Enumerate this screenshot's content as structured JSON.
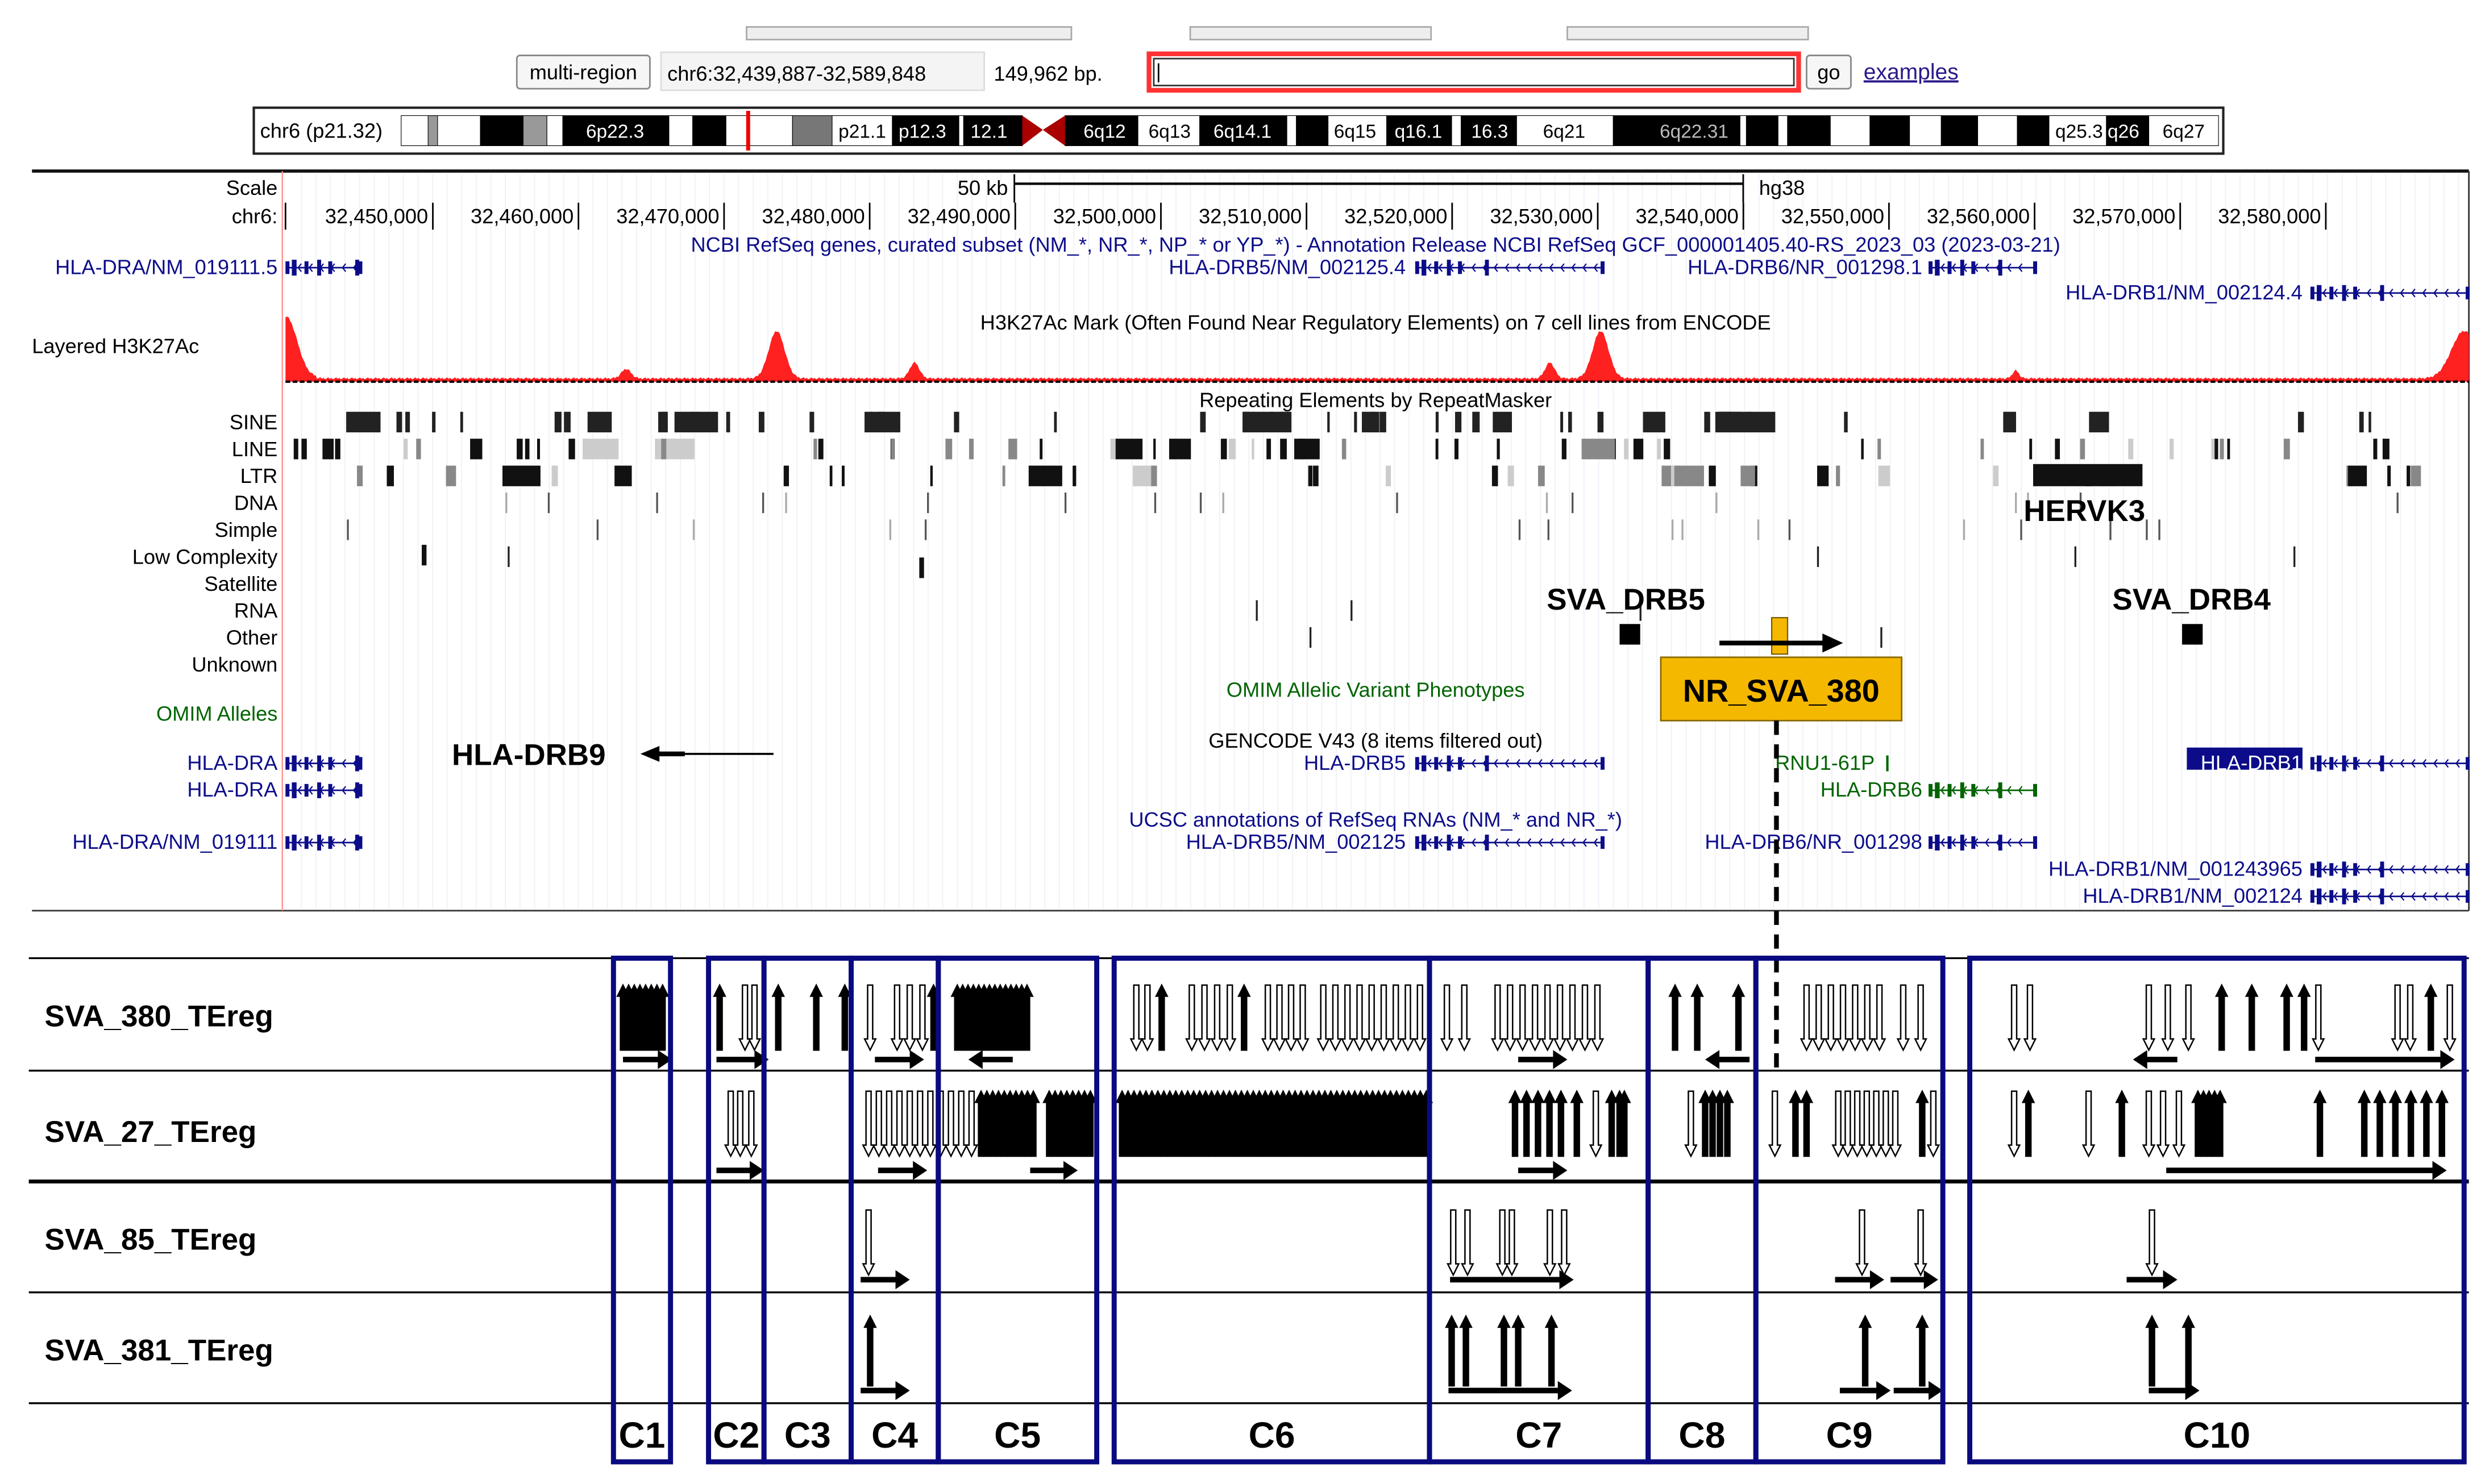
{
  "nav": {
    "multi_region_label": "multi-region",
    "position": "chr6:32,439,887-32,589,848",
    "size": "149,962 bp.",
    "search_value": "",
    "go_label": "go",
    "examples_label": "examples"
  },
  "ideogram": {
    "label": "chr6 (p21.32)",
    "bands": [
      "6p22.3",
      "p21.1",
      "p12.3",
      "12.1",
      "6q12",
      "6q13",
      "6q14.1",
      "6q15",
      "q16.1",
      "16.3",
      "6q21",
      "6q22.31",
      "q25.3",
      "q26",
      "6q27"
    ]
  },
  "scale": {
    "label": "Scale",
    "bar_label": "50 kb",
    "assembly": "hg38"
  },
  "ruler": {
    "label": "chr6:",
    "ticks": [
      "32,450,000",
      "32,460,000",
      "32,470,000",
      "32,480,000",
      "32,490,000",
      "32,500,000",
      "32,510,000",
      "32,520,000",
      "32,530,000",
      "32,540,000",
      "32,550,000",
      "32,560,000",
      "32,570,000",
      "32,580,000"
    ]
  },
  "tracks": {
    "ncbi": {
      "title": "NCBI RefSeq genes, curated subset (NM_*, NR_*, NP_* or YP_*) - Annotation Release NCBI RefSeq GCF_000001405.40-RS_2023_03 (2023-03-21)",
      "genes": [
        "HLA-DRA/NM_019111.5",
        "HLA-DRB5/NM_002125.4",
        "HLA-DRB6/NR_001298.1",
        "HLA-DRB1/NM_002124.4"
      ]
    },
    "h3k27ac": {
      "label": "Layered H3K27Ac",
      "title": "H3K27Ac Mark (Often Found Near Regulatory Elements) on 7 cell lines from ENCODE"
    },
    "repeats": {
      "title": "Repeating Elements by RepeatMasker",
      "classes": [
        "SINE",
        "LINE",
        "LTR",
        "DNA",
        "Simple",
        "Low Complexity",
        "Satellite",
        "RNA",
        "Other",
        "Unknown"
      ]
    },
    "omim": {
      "label": "OMIM Alleles",
      "title": "OMIM Allelic Variant Phenotypes"
    },
    "gencode": {
      "title": "GENCODE V43 (8 items filtered out)",
      "genes": [
        "HLA-DRA",
        "HLA-DRA",
        "HLA-DRB5",
        "RNU1-61P",
        "HLA-DRB6",
        "HLA-DRB1"
      ]
    },
    "ucsc": {
      "title": "UCSC annotations of RefSeq RNAs (NM_* and NR_*)",
      "genes": [
        "HLA-DRA/NM_019111",
        "HLA-DRB5/NM_002125",
        "HLA-DRB6/NR_001298",
        "HLA-DRB1/NM_001243965",
        "HLA-DRB1/NM_002124"
      ]
    }
  },
  "annotations": {
    "sva_drb5": "SVA_DRB5",
    "sva_drb4": "SVA_DRB4",
    "hervk3": "HERVK3",
    "hla_drb9": "HLA-DRB9",
    "nr_sva_380": "NR_SVA_380"
  },
  "tereg_rows": [
    "SVA_380_TEreg",
    "SVA_27_TEreg",
    "SVA_85_TEreg",
    "SVA_381_TEreg"
  ],
  "clusters": [
    "C1",
    "C2",
    "C3",
    "C4",
    "C5",
    "C6",
    "C7",
    "C8",
    "C9",
    "C10"
  ],
  "colors": {
    "signal": "#ff0000",
    "highlight": "#f5b800",
    "cluster_box": "#0a0a80",
    "gene_blue": "#0c0c8a",
    "gene_green": "#006400"
  }
}
